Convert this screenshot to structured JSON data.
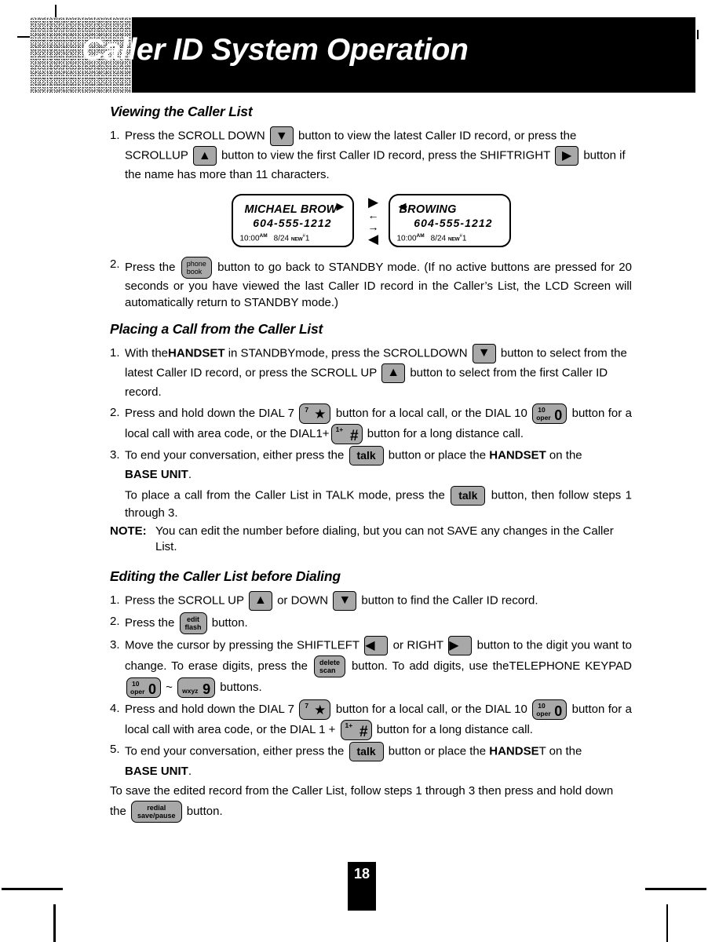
{
  "header": {
    "title": "Caller ID System Operation",
    "texture_name": "noise-swatch"
  },
  "sections": {
    "viewing": {
      "heading": "Viewing the Caller List",
      "step1": {
        "num": "1.",
        "t1": "Press the SCROLL DOWN",
        "t2": "button to view the latest Caller ID record, or press the SCROLLUP",
        "t3": "button to view the first Caller ID record, press the SHIFTRIGHT",
        "t4": "button if the name has more than 11 characters."
      },
      "step2": {
        "num": "2.",
        "t1": "Press the",
        "t2": "button to go back to STANDBY mode. (If no active buttons are pressed for 20 seconds or you have viewed the last Caller ID record in the Caller’s List, the LCD Screen will automatically return to STANDBY mode.)"
      }
    },
    "placing": {
      "heading": "Placing a Call from the Caller List",
      "step1": {
        "num": "1.",
        "t1": "With the",
        "bold1": "HANDSET",
        "t2": "in STANDBYmode, press the SCROLLDOWN",
        "t3": "button to select from the latest Caller ID record, or press the SCROLL UP",
        "t4": "button to select from the first Caller ID record."
      },
      "step2": {
        "num": "2.",
        "t1": "Press and hold down the DIAL 7",
        "t2": "button for a local call, or the DIAL 10",
        "t3": "button for a local call with area code, or the DIAL1+",
        "t4": "button for a long distance call."
      },
      "step3": {
        "num": "3.",
        "t1": "To end your conversation, either press the",
        "t2": "button or place the",
        "bold1": "HANDSET",
        "t3": "on the",
        "bold2": "BASE UNIT",
        "t4": ".",
        "t5": "To place a call from the Caller List in TALK mode, press the",
        "t6": "button, then follow steps 1 through 3."
      },
      "note": {
        "label": "NOTE:",
        "text": "You can edit the number before dialing, but you can not SAVE any changes in the Caller List."
      }
    },
    "editing": {
      "heading": "Editing the Caller List before Dialing",
      "step1": {
        "num": "1.",
        "t1": "Press the SCROLL UP",
        "t2": "or DOWN",
        "t3": "button to find the Caller ID record."
      },
      "step2": {
        "num": "2.",
        "t1": "Press the",
        "t2": "button."
      },
      "step3": {
        "num": "3.",
        "t1": "Move the cursor by pressing the SHIFTLEFT",
        "t2": "or RIGHT",
        "t3": "button to the digit you want to change. To erase digits, press the",
        "t4": "button. To add digits, use theTELEPHONE KEYPAD",
        "tilde": "~",
        "t5": "buttons."
      },
      "step4": {
        "num": "4.",
        "t1": "Press and hold down the DIAL 7",
        "t2": "button for a local call, or the DIAL 10",
        "t3": "button for a local call with area code, or the DIAL 1 +",
        "t4": "button for a long distance call."
      },
      "step5": {
        "num": "5.",
        "t1": "To end your conversation, either press the",
        "t2": "button or place the",
        "bold1": "HANDSE",
        "t3": "T on the",
        "bold2": "BASE UNIT",
        "t4": "."
      },
      "save_note": {
        "t1": "To save the edited record from the Caller List, follow steps 1 through 3 then press and hold down the",
        "t2": "button."
      }
    }
  },
  "lcd": {
    "left": {
      "name": "MICHAEL BROW",
      "number": "604-555-1212",
      "time": "10:00",
      "ampm": "AM",
      "date": "8/24",
      "new_label": "NEW",
      "new_hash": "#",
      "new_count": "1",
      "corner_arrow": "▶"
    },
    "right": {
      "name": "BROWING",
      "number": "604-555-1212",
      "time": "10:00",
      "ampm": "AM",
      "date": "8/24",
      "new_label": "NEW",
      "new_hash": "#",
      "new_count": "1",
      "corner_arrow": "◀"
    },
    "arrows": [
      "▶",
      "←",
      "→",
      "◀"
    ]
  },
  "keys": {
    "scroll_down": "▼",
    "scroll_up": "▲",
    "shift_right": "▶",
    "shift_left": "◀",
    "phonebook": {
      "l1": "phone",
      "l2": "book"
    },
    "edit_flash": {
      "l1": "edit",
      "l2": "flash"
    },
    "delete_scan": {
      "l1": "delete",
      "l2": "scan"
    },
    "redial_savepause": {
      "l1": "redial",
      "l2": "save/pause"
    },
    "talk": "talk",
    "dial7": {
      "sup": "7",
      "big": "★"
    },
    "dial0": {
      "sup": "10",
      "sub": "oper",
      "big": "0"
    },
    "dial_hash": {
      "sup": "1+",
      "big": "#"
    },
    "dial9": {
      "sub": "wxyz",
      "big": "9"
    }
  },
  "footer": {
    "page_number": "18"
  },
  "colors": {
    "key_face": "#a8a8a8",
    "banner": "#000000",
    "text": "#000000",
    "page_box": "#000000"
  }
}
